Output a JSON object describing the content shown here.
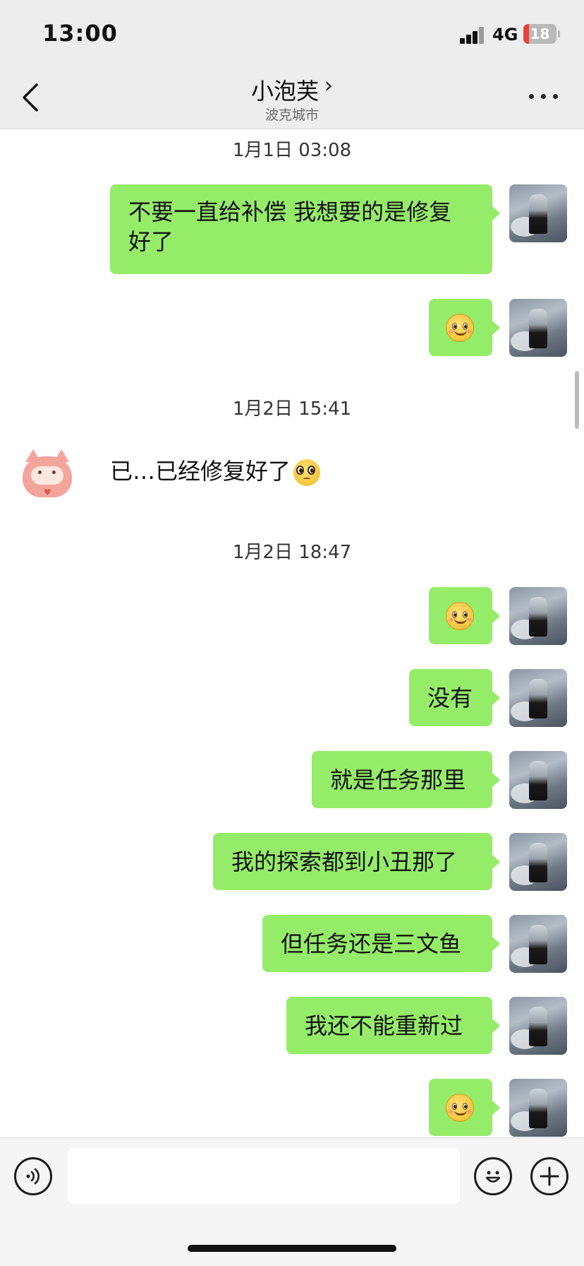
{
  "status_bar": {
    "time": "13:00",
    "network": "4G",
    "battery": "18",
    "battery_fraction": 0.18
  },
  "header": {
    "title": "小泡芙",
    "chevron": "›",
    "subtitle": "波克城市",
    "back_icon": "chevron-left-icon",
    "more_icon": "more-dots-icon"
  },
  "timestamps": [
    "1月1日 03:08",
    "1月2日 15:41",
    "1月2日 18:47"
  ],
  "messages": [
    {
      "from": "me",
      "text": "不要一直给补偿 我想要的是修复好了"
    },
    {
      "from": "me",
      "emoji": "smile-emoji"
    },
    {
      "from": "other",
      "text": "已…已经修复好了",
      "emoji": "pleading-face-emoji"
    },
    {
      "from": "me",
      "emoji": "smile-emoji"
    },
    {
      "from": "me",
      "text": "没有"
    },
    {
      "from": "me",
      "text": "就是任务那里"
    },
    {
      "from": "me",
      "text": "我的探索都到小丑那了"
    },
    {
      "from": "me",
      "text": "但任务还是三文鱼"
    },
    {
      "from": "me",
      "text": "我还不能重新过"
    },
    {
      "from": "me",
      "emoji": "smile-emoji"
    }
  ],
  "input_bar": {
    "voice_icon": "voice-icon",
    "emoji_icon": "emoji-icon",
    "plus_icon": "plus-icon",
    "placeholder": ""
  },
  "colors": {
    "my_bubble": "#95ec69",
    "topbar": "#ededed",
    "inputbar": "#f5f5f5",
    "battery_low": "#e5433b"
  }
}
